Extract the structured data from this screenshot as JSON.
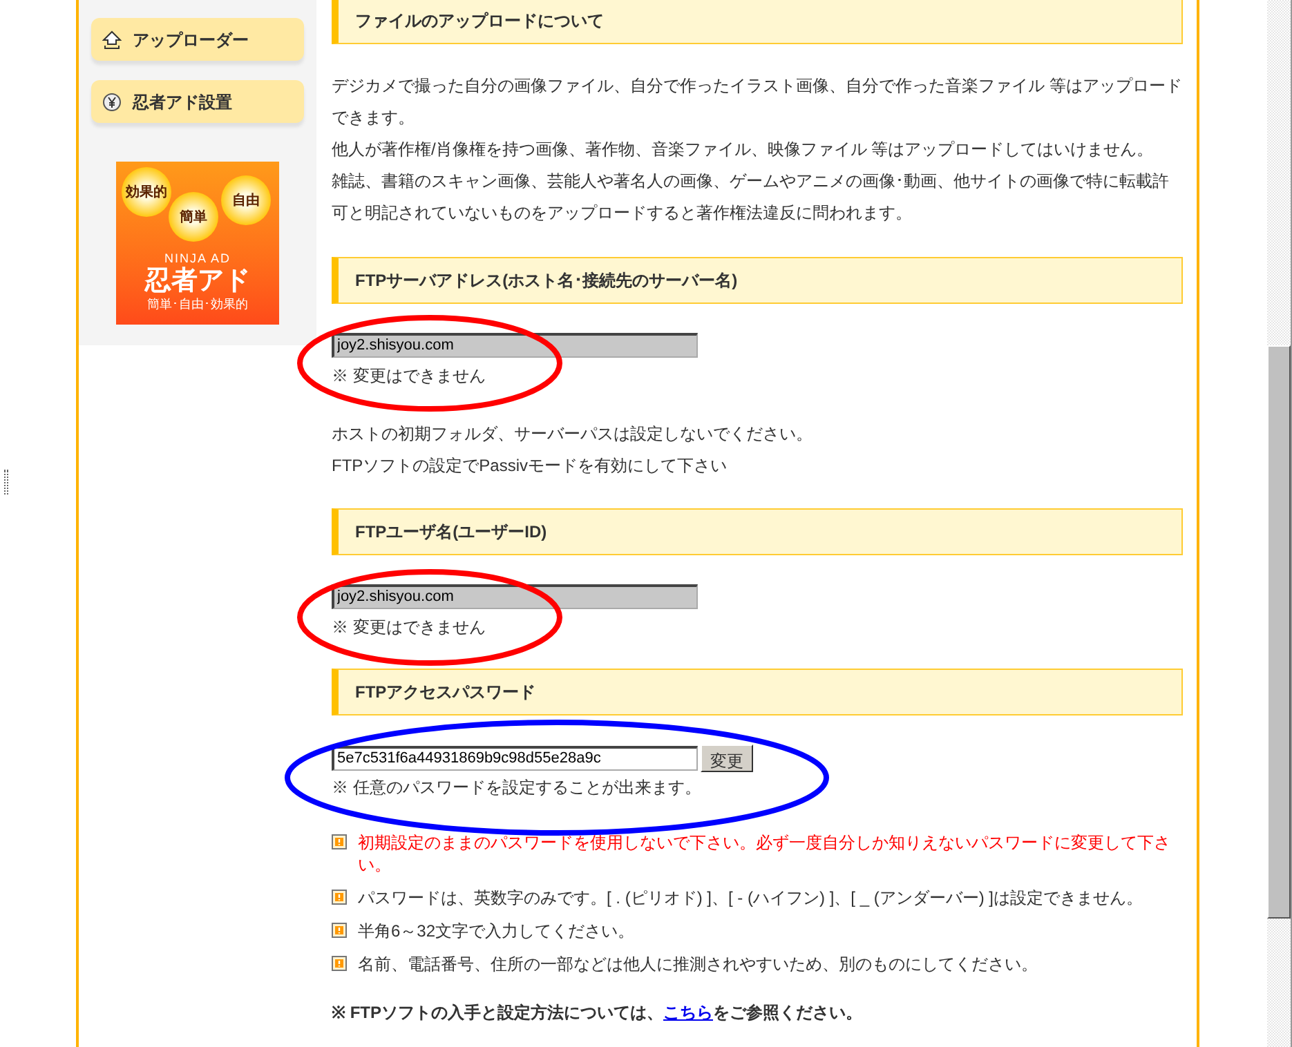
{
  "sidebar": {
    "items": [
      {
        "label": "アップローダー",
        "kind": "upload"
      },
      {
        "label": "忍者アド設置",
        "kind": "yen"
      }
    ],
    "banner": {
      "badges": [
        "効果的",
        "簡単",
        "自由"
      ],
      "brand": "NINJA AD",
      "title": "忍者アド",
      "tagline": "簡単･自由･効果的"
    }
  },
  "sections": [
    {
      "heading": "ファイルのアップロードについて",
      "paragraphs": [
        "デジカメで撮った自分の画像ファイル、自分で作ったイラスト画像、自分で作った音楽ファイル 等はアップロードできます。",
        "他人が著作権/肖像権を持つ画像、著作物、音楽ファイル、映像ファイル 等はアップロードしてはいけません。",
        "雑誌、書籍のスキャン画像、芸能人や著名人の画像、ゲームやアニメの画像･動画、他サイトの画像で特に転載許可と明記されていないものをアップロードすると著作権法違反に問われます。"
      ]
    },
    {
      "heading": "FTPサーバアドレス(ホスト名･接続先のサーバー名)",
      "field": {
        "value": "joy2.shisyou.com",
        "disabled": true
      },
      "note": "※ 変更はできません",
      "paragraphs": [
        "ホストの初期フォルダ、サーバーパスは設定しないでください。",
        "FTPソフトの設定でPassivモードを有効にして下さい"
      ]
    },
    {
      "heading": "FTPユーザ名(ユーザーID)",
      "field": {
        "value": "joy2.shisyou.com",
        "disabled": true
      },
      "note": "※ 変更はできません"
    },
    {
      "heading": "FTPアクセスパスワード",
      "field": {
        "value": "5e7c531f6a44931869b9c98d55e28a9c",
        "disabled": false
      },
      "button": "変更",
      "note": "※ 任意のパスワードを設定することが出来ます。"
    }
  ],
  "warnings": [
    {
      "text": "初期設定のままのパスワードを使用しないで下さい。必ず一度自分しか知りえないパスワードに変更して下さい。",
      "emphasis": true
    },
    {
      "text": "パスワードは、英数字のみです。[ . (ピリオド) ]、[ - (ハイフン) ]、[ _ (アンダーバー) ]は設定できません。",
      "emphasis": false
    },
    {
      "text": "半角6～32文字で入力してください。",
      "emphasis": false
    },
    {
      "text": "名前、電話番号、住所の一部などは他人に推測されやすいため、別のものにしてください。",
      "emphasis": false
    }
  ],
  "footer": {
    "before": "※ FTPソフトの入手と設定方法については、",
    "link": "こちら",
    "after": "をご参照ください。"
  },
  "annotations": [
    {
      "color": "#ff0000"
    },
    {
      "color": "#ff0000"
    },
    {
      "color": "#0000ff"
    }
  ]
}
